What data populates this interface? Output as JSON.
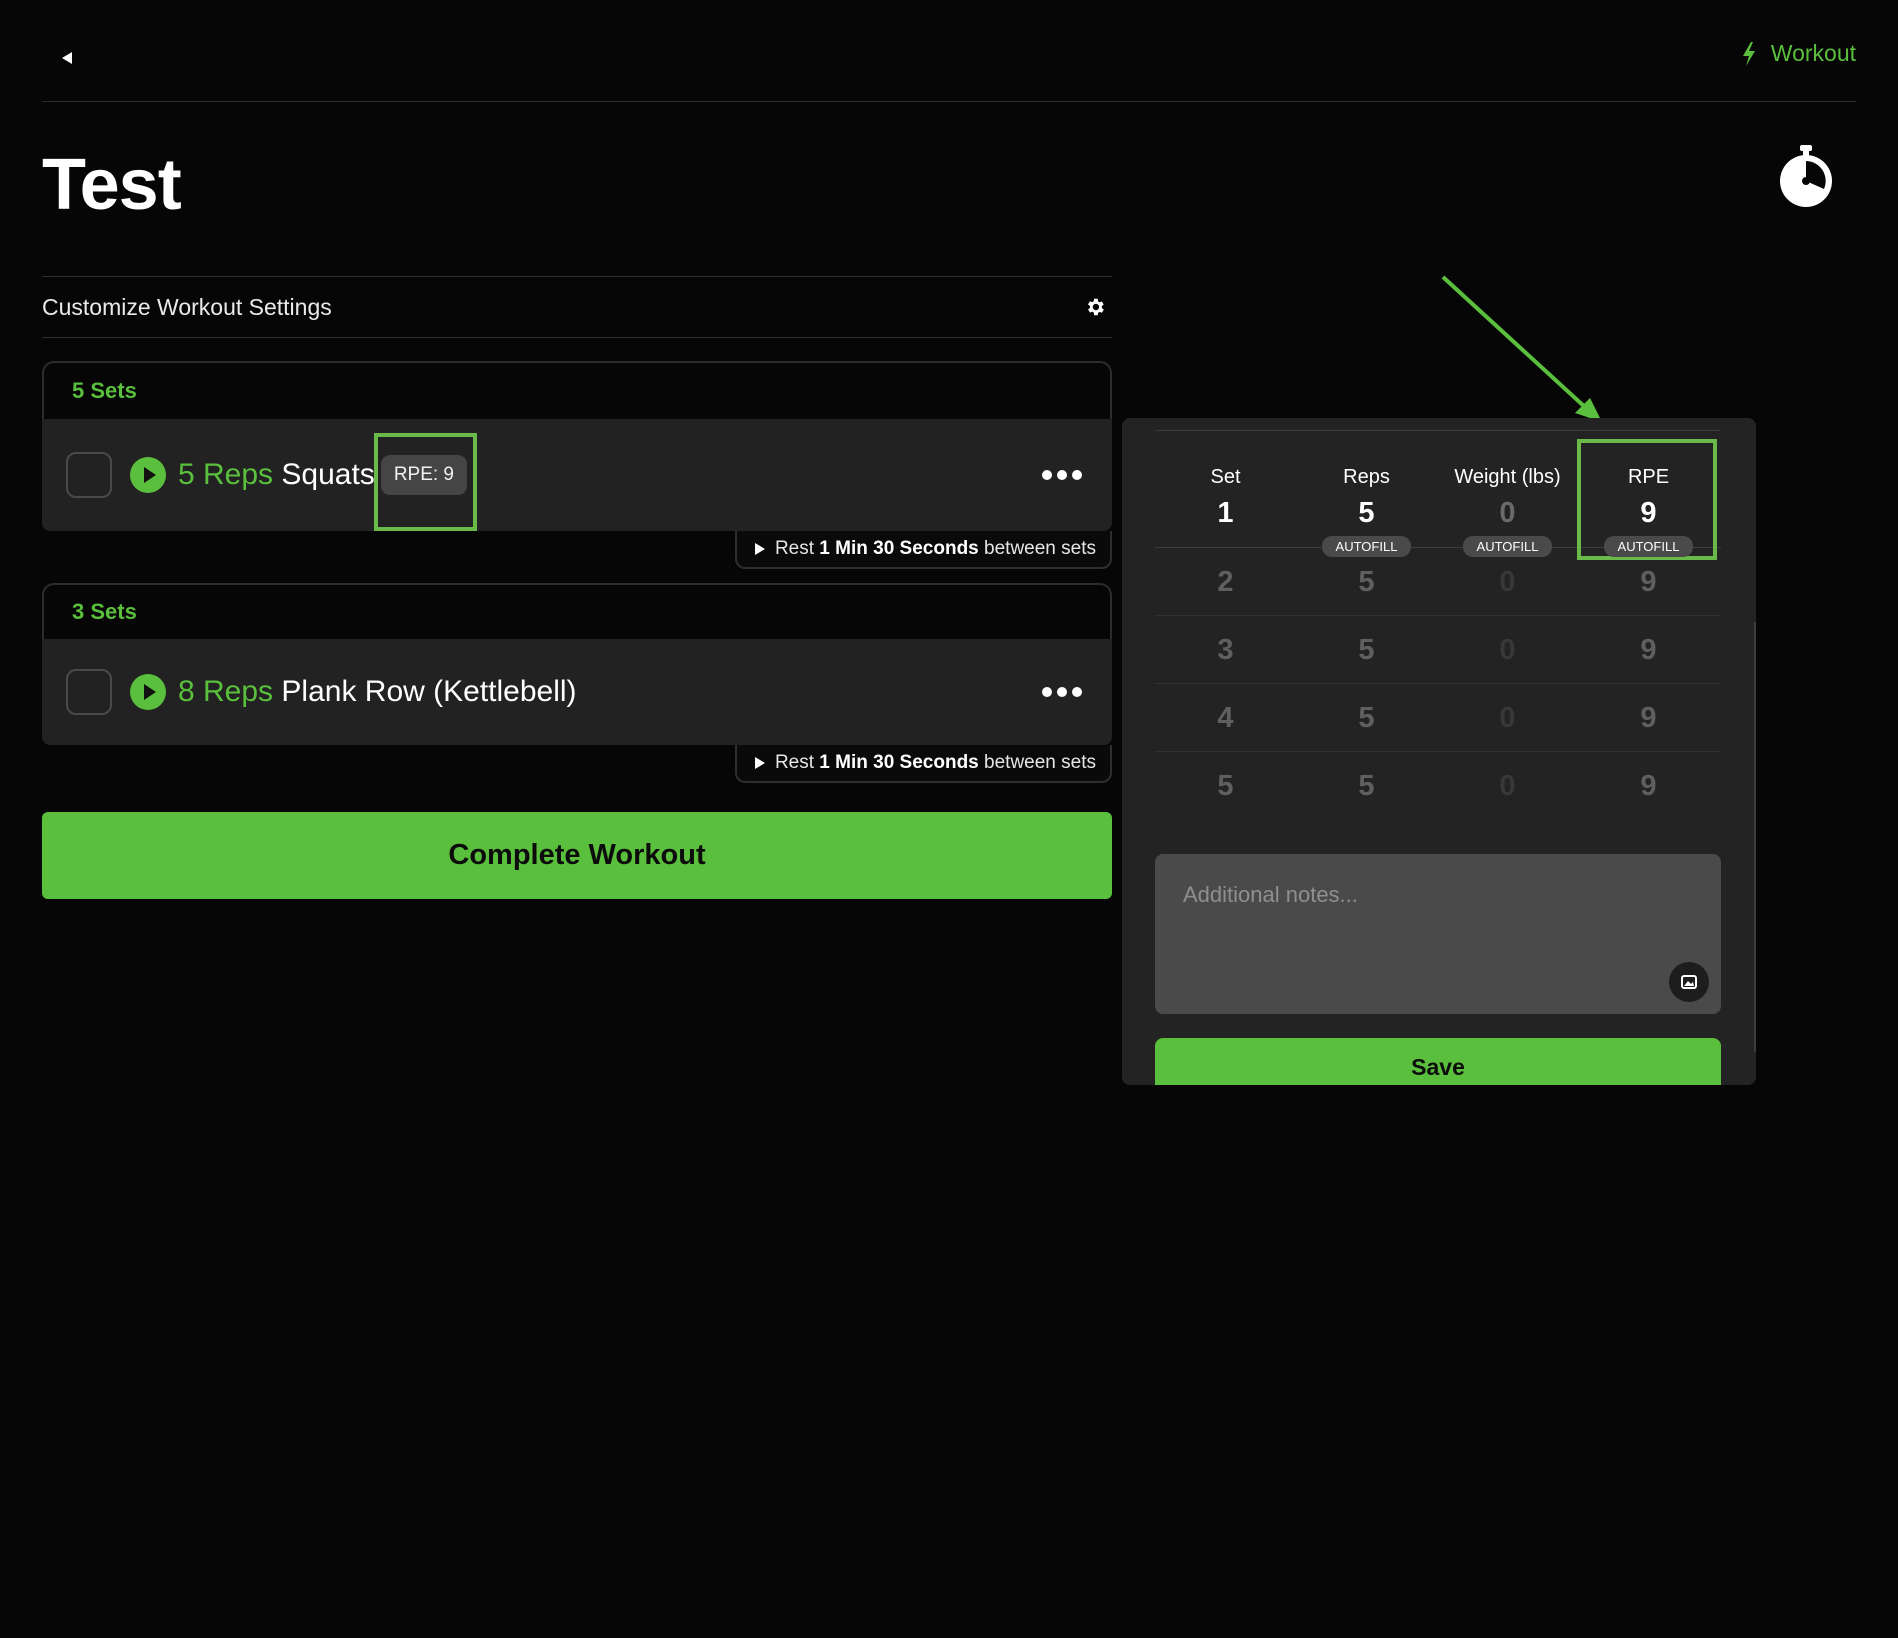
{
  "topbar": {
    "back_icon": "back-arrow-icon",
    "workout_link": "Workout",
    "workout_icon": "lightning-bolt-icon",
    "accent": "#5abf3c"
  },
  "page": {
    "title": "Test",
    "timer_icon": "stopwatch-icon"
  },
  "settings": {
    "label": "Customize Workout Settings",
    "icon": "gear-icon"
  },
  "exercises": [
    {
      "sets_label": "5 Sets",
      "reps_label": "5 Reps",
      "name": "Squats",
      "rpe_chip": "RPE: 9",
      "rest": {
        "prefix": "Rest",
        "duration": "1 Min 30 Seconds",
        "suffix": "between sets"
      }
    },
    {
      "sets_label": "3 Sets",
      "reps_label": "8 Reps",
      "name": "Plank Row (Kettlebell)",
      "rest": {
        "prefix": "Rest",
        "duration": "1 Min 30 Seconds",
        "suffix": "between sets"
      }
    }
  ],
  "complete_button": "Complete Workout",
  "set_panel": {
    "headers": {
      "set": "Set",
      "reps": "Reps",
      "weight": "Weight (lbs)",
      "rpe": "RPE"
    },
    "first_row": {
      "set": "1",
      "reps": "5",
      "weight": "0",
      "rpe": "9"
    },
    "autofill_label": "AUTOFILL",
    "rows": [
      {
        "set": "2",
        "reps": "5",
        "weight": "0",
        "rpe": "9"
      },
      {
        "set": "3",
        "reps": "5",
        "weight": "0",
        "rpe": "9"
      },
      {
        "set": "4",
        "reps": "5",
        "weight": "0",
        "rpe": "9"
      },
      {
        "set": "5",
        "reps": "5",
        "weight": "0",
        "rpe": "9"
      }
    ],
    "notes_placeholder": "Additional notes...",
    "image_icon": "image-icon",
    "save_button": "Save"
  }
}
